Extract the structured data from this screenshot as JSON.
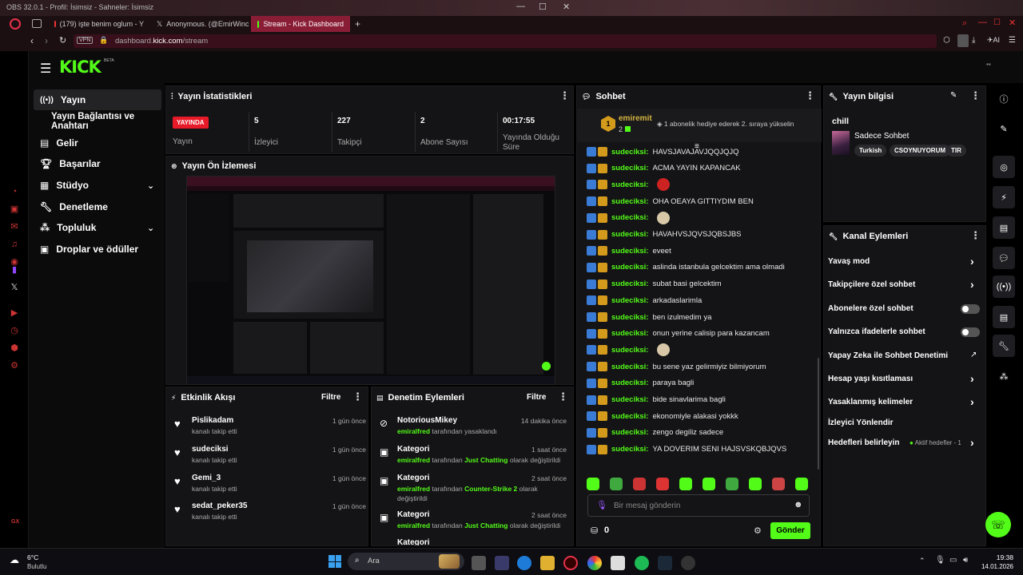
{
  "window": {
    "title": "OBS 32.0.1 - Profil: İsimsiz - Sahneler: İsimsiz"
  },
  "tabs": [
    {
      "label": "(179) işte benim oglum - Y"
    },
    {
      "label": "Anonymous. (@EmirWinc"
    },
    {
      "label": "Stream - Kick Dashboard"
    }
  ],
  "browser": {
    "vpn": "VPN",
    "url_prefix": "dashboard.",
    "url_host": "kick.com",
    "url_path": "/stream",
    "ai": "AI"
  },
  "brand": {
    "logo": "KICK",
    "beta": "BETA"
  },
  "nav": {
    "items": [
      {
        "label": "Yayın"
      },
      {
        "label": "Yayın Bağlantısı ve Anahtarı"
      },
      {
        "label": "Gelir"
      },
      {
        "label": "Başarılar"
      },
      {
        "label": "Stüdyo"
      },
      {
        "label": "Denetleme"
      },
      {
        "label": "Topluluk"
      },
      {
        "label": "Droplar ve ödüller"
      }
    ]
  },
  "stats": {
    "title": "Yayın İstatistikleri",
    "live_badge": "YAYINDA",
    "live_label": "Yayın",
    "items": [
      {
        "value": "5",
        "label": "İzleyici"
      },
      {
        "value": "227",
        "label": "Takipçi"
      },
      {
        "value": "2",
        "label": "Abone Sayısı"
      },
      {
        "value": "00:17:55",
        "label": "Yayında Olduğu Süre"
      }
    ]
  },
  "preview": {
    "title": "Yayın Ön İzlemesi"
  },
  "activity": {
    "title": "Etkinlik Akışı",
    "filter": "Filtre",
    "items": [
      {
        "user": "Pislikadam",
        "action": "kanalı takip etti",
        "time": "1 gün önce"
      },
      {
        "user": "sudeciksi",
        "action": "kanalı takip etti",
        "time": "1 gün önce"
      },
      {
        "user": "Gemi_3",
        "action": "kanalı takip etti",
        "time": "1 gün önce"
      },
      {
        "user": "sedat_peker35",
        "action": "kanalı takip etti",
        "time": "1 gün önce"
      }
    ]
  },
  "moderation": {
    "title": "Denetim Eylemleri",
    "filter": "Filtre",
    "items": [
      {
        "title": "NotoriousMikey",
        "by": "emiralfred",
        "desc": "tarafından yasaklandı",
        "time": "14 dakika önce"
      },
      {
        "title": "Kategori",
        "by": "emiralfred",
        "desc": "tarafından",
        "cat": "Just Chatting",
        "tail": "olarak değiştirildi",
        "time": "1 saat önce"
      },
      {
        "title": "Kategori",
        "by": "emiralfred",
        "desc": "tarafından",
        "cat": "Counter-Strike 2",
        "tail": "olarak",
        "tail2": "değiştirildi",
        "time": "2 saat önce"
      },
      {
        "title": "Kategori",
        "by": "emiralfred",
        "desc": "tarafından",
        "cat": "Just Chatting",
        "tail": "olarak değiştirildi",
        "time": "2 saat önce"
      },
      {
        "title": "Kategori"
      }
    ]
  },
  "chat": {
    "title": "Sohbet",
    "pinned_user": "emiremit",
    "pinned_count": "2",
    "pinned_text": "1 abonelik hediye ederek 2. sıraya yükselin",
    "input_placeholder": "Bir mesaj gönderin",
    "points": "0",
    "send": "Gönder",
    "messages": [
      {
        "user": "sudeciksi:",
        "text": "HAVSJAVAJAVJQQJQJQ"
      },
      {
        "user": "sudeciksi:",
        "text": "ACMA YAYIN KAPANCAK"
      },
      {
        "user": "sudeciksi:",
        "text": ""
      },
      {
        "user": "sudeciksi:",
        "text": "OHA OEAYA GITTIYDIM BEN"
      },
      {
        "user": "sudeciksi:",
        "text": ""
      },
      {
        "user": "sudeciksi:",
        "text": "HAVAHVSJQVSJQBSJBS"
      },
      {
        "user": "sudeciksi:",
        "text": "eveet"
      },
      {
        "user": "sudeciksi:",
        "text": "aslinda istanbula gelcektim ama olmadi"
      },
      {
        "user": "sudeciksi:",
        "text": "subat basi gelcektim"
      },
      {
        "user": "sudeciksi:",
        "text": "arkadaslarimla"
      },
      {
        "user": "sudeciksi:",
        "text": "ben izulmedim ya"
      },
      {
        "user": "sudeciksi:",
        "text": "onun yerine calisip para kazancam"
      },
      {
        "user": "sudeciksi:",
        "text": ""
      },
      {
        "user": "sudeciksi:",
        "text": "bu sene yaz gelirmiyiz bilmiyorum"
      },
      {
        "user": "sudeciksi:",
        "text": "paraya bagli"
      },
      {
        "user": "sudeciksi:",
        "text": "bide sinavlarima bagli"
      },
      {
        "user": "sudeciksi:",
        "text": "ekonomiyle alakasi yokkk"
      },
      {
        "user": "sudeciksi:",
        "text": "zengo degiliz sadece"
      },
      {
        "user": "sudeciksi:",
        "text": "YA DOVERIM SENI HAJSVSKQBJQVS"
      }
    ],
    "emote_colors": [
      "#53fc18",
      "#3fa93f",
      "#c33",
      "#d33",
      "#53fc18",
      "#53fc18",
      "#3fa93f",
      "#53fc18",
      "#c44",
      "#53fc18"
    ]
  },
  "streaminfo": {
    "title": "Yayın bilgisi",
    "stream_title": "chill",
    "category": "Sadece Sohbet",
    "tags": [
      "Turkish",
      "CSOYNUYORUM",
      "TIR"
    ]
  },
  "channel_actions": {
    "title": "Kanal Eylemleri",
    "items": [
      {
        "label": "Yavaş mod",
        "ctrl": "chevron"
      },
      {
        "label": "Takipçilere özel sohbet",
        "ctrl": "chevron"
      },
      {
        "label": "Abonelere özel sohbet",
        "ctrl": "toggle"
      },
      {
        "label": "Yalnızca ifadelerle sohbet",
        "ctrl": "toggle"
      },
      {
        "label": "Yapay Zeka ile Sohbet Denetimi",
        "ctrl": "external"
      },
      {
        "label": "Hesap yaşı kısıtlaması",
        "ctrl": "chevron"
      },
      {
        "label": "Yasaklanmış kelimeler",
        "ctrl": "chevron"
      },
      {
        "label": "İzleyici Yönlendir",
        "ctrl": "none"
      },
      {
        "label": "Hedefleri belirleyin",
        "ctrl": "chevron",
        "note": "Aktif hedefler - 1"
      }
    ]
  },
  "taskbar": {
    "weather_temp": "6°C",
    "weather_desc": "Bulutlu",
    "search": "Ara",
    "time": "19:38",
    "date": "14.01.2026"
  },
  "opera": {
    "gx": "GX"
  }
}
